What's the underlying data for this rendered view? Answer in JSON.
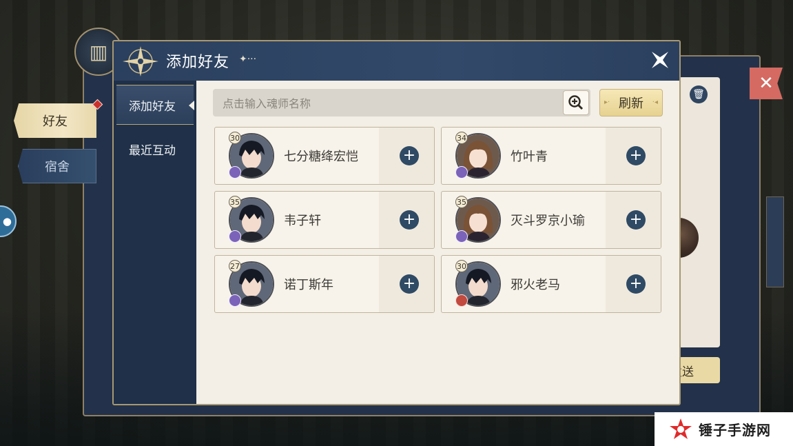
{
  "dialog": {
    "title": "添加好友",
    "title_deco": "✦···",
    "close_glyph": "✕"
  },
  "sidebar": {
    "items": [
      {
        "label": "添加好友"
      },
      {
        "label": "最近互动"
      }
    ]
  },
  "background_tabs": {
    "friends": "好友",
    "dorm": "宿舍",
    "send_fragment": "发送"
  },
  "search": {
    "placeholder": "点击输入魂师名称",
    "refresh_label": "刷新"
  },
  "players": [
    {
      "level": "30",
      "name": "七分糖绛宏恺",
      "gender": "male",
      "spirit": "purple"
    },
    {
      "level": "34",
      "name": "竹叶青",
      "gender": "female",
      "spirit": "purple"
    },
    {
      "level": "35",
      "name": "韦子轩",
      "gender": "male",
      "spirit": "purple"
    },
    {
      "level": "35",
      "name": "灭斗罗京小瑜",
      "gender": "female",
      "spirit": "purple"
    },
    {
      "level": "27",
      "name": "诺丁斯年",
      "gender": "male",
      "spirit": "purple"
    },
    {
      "level": "30",
      "name": "邪火老马",
      "gender": "male",
      "spirit": "fire"
    }
  ],
  "watermark": {
    "text": "锤子手游网"
  },
  "colors": {
    "accent_gold": "#e6d291",
    "panel_navy": "#1f3048",
    "add_button": "#2f4a64"
  }
}
